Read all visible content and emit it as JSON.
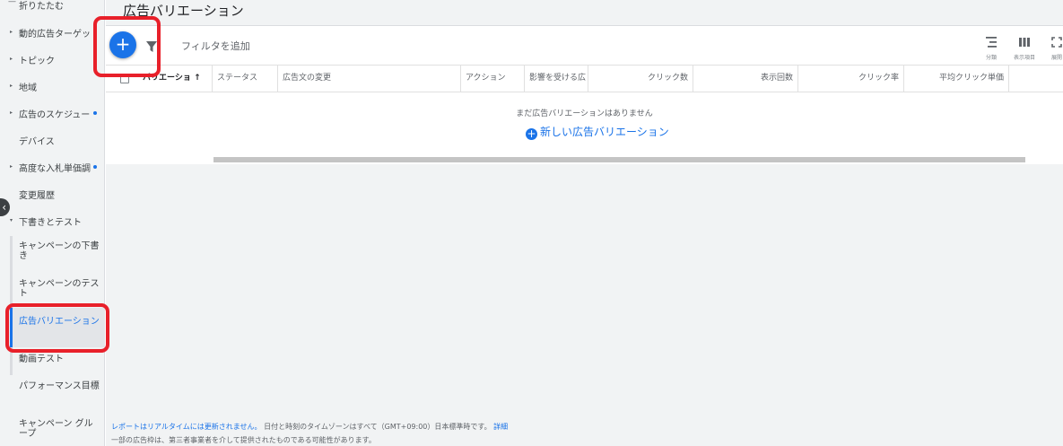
{
  "sidebar": {
    "items": [
      {
        "label": "折りたたむ",
        "prefix": "—"
      },
      {
        "label": "動的広告ターゲッ",
        "prefix": "▸"
      },
      {
        "label": "トピック",
        "prefix": "▸"
      },
      {
        "label": "地域",
        "prefix": "▸"
      },
      {
        "label": "広告のスケジュー",
        "prefix": "▸"
      },
      {
        "label": "デバイス",
        "prefix": ""
      },
      {
        "label": "高度な入札単価調",
        "prefix": "▸"
      },
      {
        "label": "変更履歴",
        "prefix": ""
      },
      {
        "label": "下書きとテスト",
        "prefix": "▾"
      }
    ],
    "sub_items": [
      {
        "label": "キャンペーンの下書き"
      },
      {
        "label": "キャンペーンのテスト"
      },
      {
        "label": "広告バリエーション"
      },
      {
        "label": "動画テスト"
      },
      {
        "label": "パフォーマンス目標"
      },
      {
        "label": "キャンペーン グループ"
      }
    ],
    "collapse_glyph": "‹"
  },
  "page": {
    "title": "広告バリエーション"
  },
  "toolbar": {
    "add_glyph": "+",
    "filter_label": "フィルタを追加",
    "segment_label": "分類",
    "columns_label": "表示項目",
    "expand_label": "展開"
  },
  "table": {
    "columns": [
      "バリエーション",
      "ステータス",
      "広告文の変更",
      "アクション",
      "影響を受ける広",
      "クリック数",
      "表示回数",
      "クリック率",
      "平均クリック単価"
    ],
    "sort_arrow": "↑",
    "empty_message": "まだ広告バリエーションはありません",
    "new_link": "新しい広告バリエーション",
    "new_link_glyph": "+"
  },
  "footer": {
    "line1_link": "レポートはリアルタイムには更新されません。",
    "line1_text": " 日付と時刻のタイムゾーンはすべて（GMT+09:00）日本標準時です。 ",
    "line1_detail": "詳細",
    "line2": "一部の広告枠は、第三者事業者を介して提供されたものである可能性があります。"
  },
  "colors": {
    "accent": "#1a73e8",
    "highlight": "#e8202a",
    "sidebar_bg": "#f1f3f4"
  },
  "icons": [
    "add-icon",
    "filter-icon",
    "segment-icon",
    "columns-icon",
    "expand-icon",
    "collapse-icon"
  ]
}
